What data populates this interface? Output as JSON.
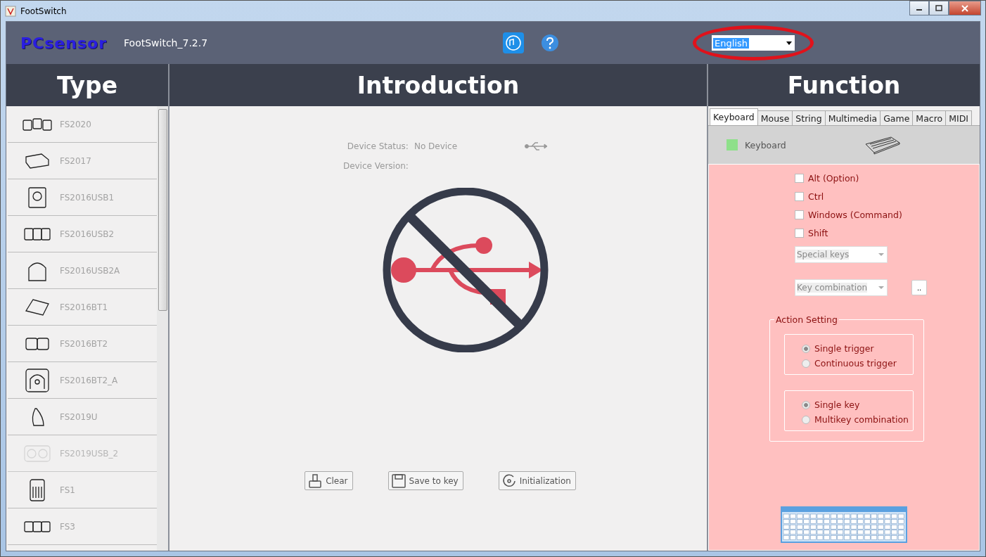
{
  "window": {
    "title": "FootSwitch"
  },
  "header": {
    "logo": "PCsensor",
    "version": "FootSwitch_7.2.7",
    "language": "English"
  },
  "type_panel": {
    "title": "Type",
    "items": [
      {
        "label": "FS2020",
        "disabled": false
      },
      {
        "label": "FS2017",
        "disabled": false
      },
      {
        "label": "FS2016USB1",
        "disabled": false
      },
      {
        "label": "FS2016USB2",
        "disabled": false
      },
      {
        "label": "FS2016USB2A",
        "disabled": false
      },
      {
        "label": "FS2016BT1",
        "disabled": false
      },
      {
        "label": "FS2016BT2",
        "disabled": false
      },
      {
        "label": "FS2016BT2_A",
        "disabled": false
      },
      {
        "label": "FS2019U",
        "disabled": false
      },
      {
        "label": "FS2019USB_2",
        "disabled": true
      },
      {
        "label": "FS1",
        "disabled": false
      },
      {
        "label": "FS3",
        "disabled": false
      }
    ]
  },
  "introduction": {
    "title": "Introduction",
    "status_label": "Device Status:",
    "status_value": "No Device",
    "version_label": "Device Version:",
    "buttons": [
      {
        "kind": "clear",
        "label": "Clear"
      },
      {
        "kind": "save",
        "label": "Save to key"
      },
      {
        "kind": "init",
        "label": "Initialization"
      }
    ]
  },
  "function": {
    "title": "Function",
    "tabs": [
      {
        "label": "Keyboard",
        "selected": true
      },
      {
        "label": "Mouse",
        "selected": false
      },
      {
        "label": "String",
        "selected": false
      },
      {
        "label": "Multimedia",
        "selected": false
      },
      {
        "label": "Game",
        "selected": false
      },
      {
        "label": "Macro",
        "selected": false
      },
      {
        "label": "MIDI",
        "selected": false
      }
    ],
    "mode_label": "Keyboard",
    "modifiers": [
      {
        "label": "Alt (Option)",
        "checked": false
      },
      {
        "label": "Ctrl",
        "checked": false
      },
      {
        "label": "Windows (Command)",
        "checked": false
      },
      {
        "label": "Shift",
        "checked": false
      }
    ],
    "special_keys": {
      "placeholder": "Special keys"
    },
    "key_combination": {
      "placeholder": "Key combination"
    },
    "more_button": "..",
    "action_setting": {
      "title": "Action Setting",
      "groups": [
        [
          {
            "label": "Single trigger",
            "selected": true
          },
          {
            "label": "Continuous trigger",
            "selected": false
          }
        ],
        [
          {
            "label": "Single key",
            "selected": true
          },
          {
            "label": "Multikey  combination",
            "selected": false
          }
        ]
      ]
    }
  }
}
